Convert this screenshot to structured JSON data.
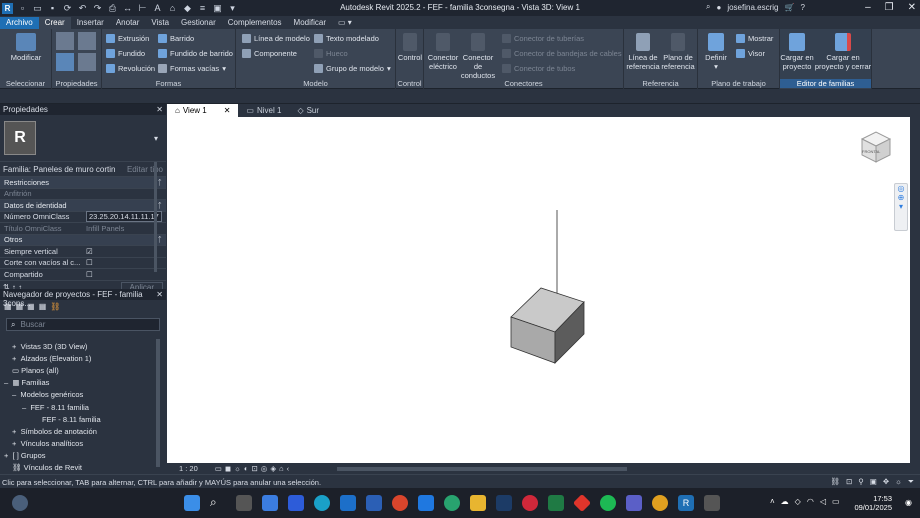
{
  "app": {
    "title": "Autodesk Revit 2025.2 - FEF - familia 3consegna - Vista 3D: View 1",
    "user": "josefina.escrig"
  },
  "tabs": [
    "Archivo",
    "Crear",
    "Insertar",
    "Anotar",
    "Vista",
    "Gestionar",
    "Complementos",
    "Modificar"
  ],
  "ribbon": {
    "modificar": "Modificar",
    "extrusion": "Extrusión",
    "barrido": "Barrido",
    "fundido": "Fundido",
    "fundido_barrido": "Fundido de barrido",
    "revolucion": "Revolución",
    "formas_vacias": "Formas vacías",
    "linea_modelo": "Línea de modelo",
    "texto_modelado": "Texto modelado",
    "componente": "Componente",
    "hueco": "Hueco",
    "grupo_modelo": "Grupo de modelo",
    "control": "Control",
    "conector_electrico": "Conector eléctrico",
    "conector_conductos": "Conector de conductos",
    "conector_tuberias": "Conector de tuberías",
    "conector_bandejas": "Conector de bandejas de cables",
    "conector_tubos": "Conector de tubos",
    "linea_referencia": "Línea de referencia",
    "plano_referencia": "Plano de referencia",
    "definir": "Definir",
    "mostrar": "Mostrar",
    "visor": "Visor",
    "cargar_proyecto": "Cargar en proyecto",
    "cargar_cerrar": "Cargar en proyecto y cerrar",
    "panels": {
      "seleccionar": "Seleccionar",
      "propiedades": "Propiedades",
      "formas": "Formas",
      "modelo": "Modelo",
      "control": "Control",
      "conectores": "Conectores",
      "referencia": "Referencia",
      "plano_trabajo": "Plano de trabajo",
      "editor": "Editor de familias"
    }
  },
  "properties": {
    "title": "Propiedades",
    "family": "Familia: Paneles de muro cortin",
    "edit_type": "Editar tipo",
    "restricciones": "Restricciones",
    "anfitrion": "Anfitrión",
    "datos": "Datos de identidad",
    "omniclass_num_label": "Número OmniClass",
    "omniclass_num_value": "23.25.20.14.11.11.17",
    "omniclass_title_label": "Título OmniClass",
    "omniclass_title_value": "Infill Panels",
    "otros": "Otros",
    "siempre_vertical": "Siempre vertical",
    "corte_vacios": "Corte con vacíos al c...",
    "compartido": "Compartido",
    "aplicar": "Aplicar"
  },
  "browser": {
    "title": "Navegador de proyectos - FEF - familia 3cons...",
    "search": "Buscar",
    "items": [
      "Vistas 3D (3D View)",
      "Alzados (Elevation 1)",
      "Planos (all)",
      "Familias",
      "Modelos genéricos",
      "FEF - 8.11 familia",
      "FEF - 8.11 familia",
      "Símbolos de anotación",
      "Vínculos analíticos",
      "Grupos",
      "Vínculos de Revit"
    ]
  },
  "viewtabs": [
    "View 1",
    "Nivel 1",
    "Sur"
  ],
  "viewbar": {
    "scale": "1 : 20"
  },
  "status": "Clic para seleccionar, TAB para alternar, CTRL para añadir y MAYÚS para anular una selección.",
  "clock": {
    "time": "17:53",
    "date": "09/01/2025"
  },
  "viewcube": {
    "label": "FRONTAL"
  }
}
